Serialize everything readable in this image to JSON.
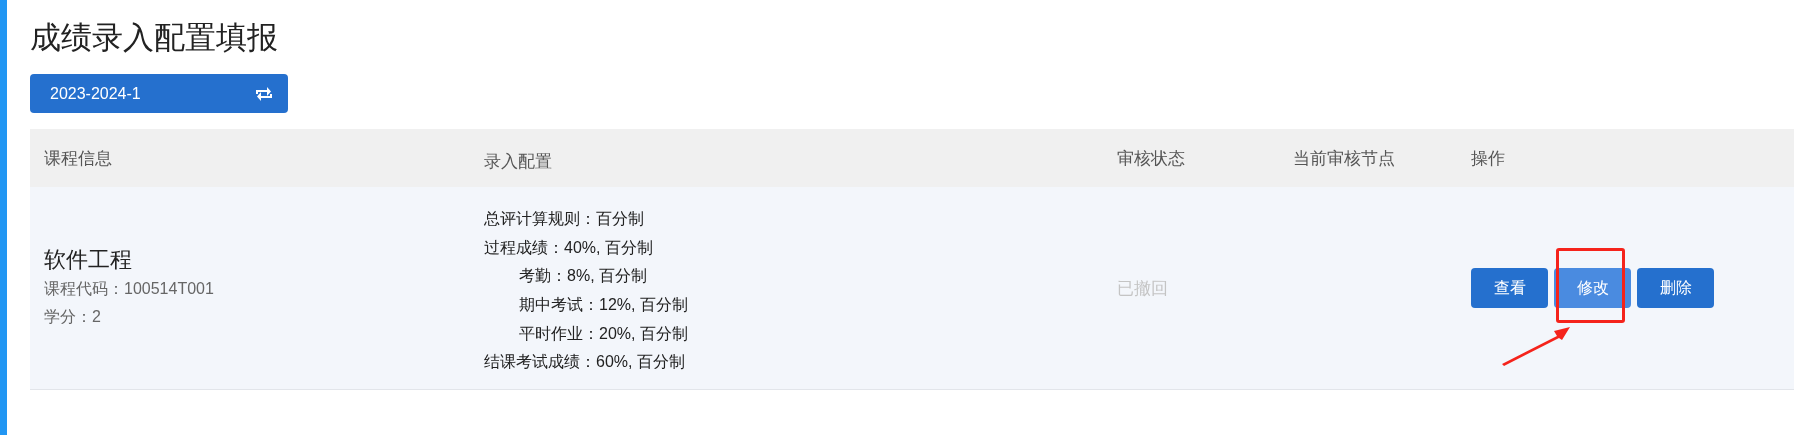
{
  "page_title": "成绩录入配置填报",
  "term_select": {
    "value": "2023-2024-1"
  },
  "table": {
    "columns": [
      "课程信息",
      "录入配置",
      "审核状态",
      "当前审核节点",
      "操作"
    ],
    "rows": [
      {
        "course": {
          "name": "软件工程",
          "code": "课程代码：100514T001",
          "credit": "学分：2"
        },
        "config": [
          {
            "text": "总评计算规则：百分制"
          },
          {
            "text": "过程成绩：40%, 百分制",
            "children": [
              {
                "text": "考勤：8%, 百分制"
              },
              {
                "text": "期中考试：12%, 百分制"
              },
              {
                "text": "平时作业：20%, 百分制"
              }
            ]
          },
          {
            "text": "结课考试成绩：60%, 百分制"
          }
        ],
        "status": {
          "text": "已撤回",
          "disabled": true
        },
        "actions": [
          {
            "label": "查看",
            "hovered": false,
            "highlighted": false
          },
          {
            "label": "修改",
            "hovered": true,
            "highlighted": true
          },
          {
            "label": "删除",
            "hovered": false,
            "highlighted": false
          }
        ]
      }
    ]
  }
}
